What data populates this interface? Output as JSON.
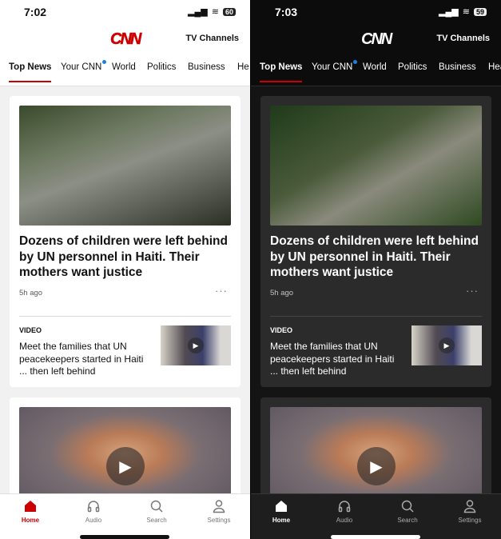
{
  "screens": [
    {
      "theme": "light",
      "time": "7:02",
      "battery": "60",
      "logo": "CNN",
      "tv_channels": "TV Channels",
      "tabs": [
        {
          "label": "Top News",
          "active": true
        },
        {
          "label": "Your CNN",
          "badge": true
        },
        {
          "label": "World"
        },
        {
          "label": "Politics"
        },
        {
          "label": "Business"
        },
        {
          "label": "He"
        }
      ],
      "story": {
        "headline": "Dozens of children were left behind by UN personnel in Haiti. Their mothers want justice",
        "time_ago": "5h ago",
        "more": "···",
        "video_label": "VIDEO",
        "video_title": "Meet the families that UN peacekeepers started in Haiti ... then left behind"
      },
      "nav": [
        {
          "label": "Home",
          "icon": "home-icon",
          "active": true
        },
        {
          "label": "Audio",
          "icon": "headphones-icon"
        },
        {
          "label": "Search",
          "icon": "search-icon"
        },
        {
          "label": "Settings",
          "icon": "person-icon"
        }
      ]
    },
    {
      "theme": "dark",
      "time": "7:03",
      "battery": "59",
      "logo": "CNN",
      "tv_channels": "TV Channels",
      "tabs": [
        {
          "label": "Top News",
          "active": true
        },
        {
          "label": "Your CNN",
          "badge": true
        },
        {
          "label": "World"
        },
        {
          "label": "Politics"
        },
        {
          "label": "Business"
        },
        {
          "label": "Hea"
        }
      ],
      "story": {
        "headline": "Dozens of children were left behind by UN personnel in Haiti. Their mothers want justice",
        "time_ago": "5h ago",
        "more": "···",
        "video_label": "VIDEO",
        "video_title": "Meet the families that UN peacekeepers started in Haiti ... then left behind"
      },
      "nav": [
        {
          "label": "Home",
          "icon": "home-icon",
          "active": true
        },
        {
          "label": "Audio",
          "icon": "headphones-icon"
        },
        {
          "label": "Search",
          "icon": "search-icon"
        },
        {
          "label": "Settings",
          "icon": "person-icon"
        }
      ]
    }
  ],
  "colors": {
    "accent": "#cc0000",
    "badge": "#1e7ee6"
  }
}
